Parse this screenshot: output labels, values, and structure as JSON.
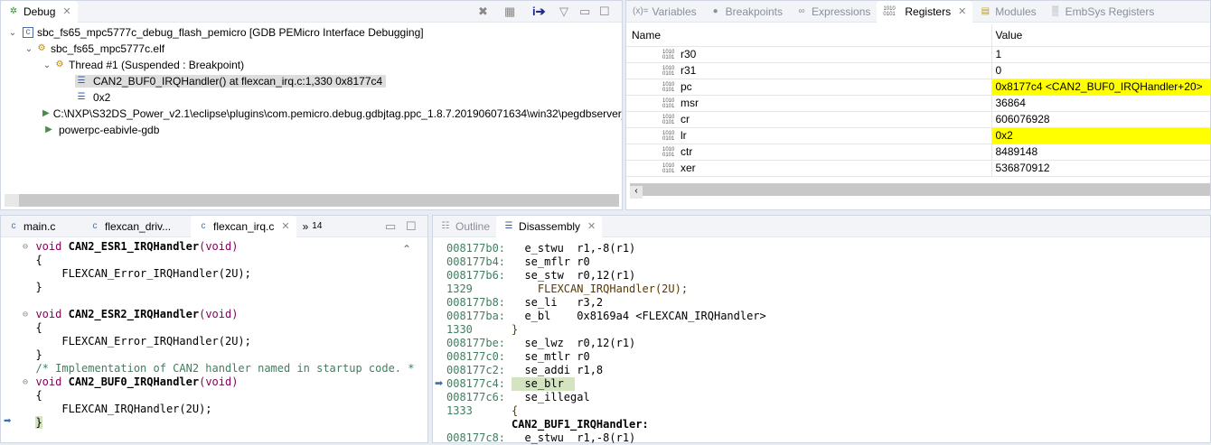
{
  "debug": {
    "tab": "Debug",
    "tree": [
      {
        "label": "sbc_fs65_mpc5777c_debug_flash_pemicro [GDB PEMicro Interface Debugging]"
      },
      {
        "label": "sbc_fs65_mpc5777c.elf"
      },
      {
        "label": "Thread #1 (Suspended : Breakpoint)"
      },
      {
        "label": "CAN2_BUF0_IRQHandler() at flexcan_irq.c:1,330 0x8177c4"
      },
      {
        "label": "0x2"
      },
      {
        "label": "C:\\NXP\\S32DS_Power_v2.1\\eclipse\\plugins\\com.pemicro.debug.gdbjtag.ppc_1.8.7.201906071634\\win32\\pegdbserver_"
      },
      {
        "label": "powerpc-eabivle-gdb"
      }
    ]
  },
  "views": {
    "tabs": [
      "Variables",
      "Breakpoints",
      "Expressions",
      "Registers",
      "Modules",
      "EmbSys Registers"
    ],
    "variables_prefix": "(x)="
  },
  "registers": {
    "headers": [
      "Name",
      "Value"
    ],
    "rows": [
      {
        "name": "r30",
        "value": "1"
      },
      {
        "name": "r31",
        "value": "0"
      },
      {
        "name": "pc",
        "value": "0x8177c4 <CAN2_BUF0_IRQHandler+20>",
        "changed": true
      },
      {
        "name": "msr",
        "value": "36864"
      },
      {
        "name": "cr",
        "value": "606076928"
      },
      {
        "name": "lr",
        "value": "0x2",
        "changed": true
      },
      {
        "name": "ctr",
        "value": "8489148"
      },
      {
        "name": "xer",
        "value": "536870912"
      }
    ],
    "highlight_color": "#ffff00",
    "bin_icon": "1010 0101"
  },
  "editor": {
    "tabs": [
      "main.c",
      "flexcan_driv...",
      "flexcan_irq.c"
    ],
    "overflow": "»",
    "overflow_count": "14",
    "lines": [
      {
        "kw": "void",
        "fn": "CAN2_ESR1_IRQHandler",
        "args": "(void)"
      },
      {
        "t": "{"
      },
      {
        "t": "    FLEXCAN_Error_IRQHandler(2U);"
      },
      {
        "t": "}"
      },
      {
        "t": ""
      },
      {
        "kw": "void",
        "fn": "CAN2_ESR2_IRQHandler",
        "args": "(void)"
      },
      {
        "t": "{"
      },
      {
        "t": "    FLEXCAN_Error_IRQHandler(2U);"
      },
      {
        "t": "}"
      },
      {
        "c": "/* Implementation of CAN2 handler named in startup code. *"
      },
      {
        "kw": "void",
        "fn": "CAN2_BUF0_IRQHandler",
        "args": "(void)"
      },
      {
        "t": "{"
      },
      {
        "t": "    FLEXCAN_IRQHandler(2U);"
      },
      {
        "t": "}"
      }
    ]
  },
  "disasm": {
    "tabs": [
      "Outline",
      "Disassembly"
    ],
    "lines": [
      {
        "a": "008177b0:",
        "i": "  e_stwu  r1,-8(r1)"
      },
      {
        "a": "008177b4:",
        "i": "  se_mflr r0"
      },
      {
        "a": "008177b6:",
        "i": "  se_stw  r0,12(r1)"
      },
      {
        "a": "1329",
        "i": "    FLEXCAN_IRQHandler(2U);"
      },
      {
        "a": "008177b8:",
        "i": "  se_li   r3,2"
      },
      {
        "a": "008177ba:",
        "i": "  e_bl    0x8169a4 <FLEXCAN_IRQHandler>"
      },
      {
        "a": "1330",
        "i": "}"
      },
      {
        "a": "008177be:",
        "i": "  se_lwz  r0,12(r1)"
      },
      {
        "a": "008177c0:",
        "i": "  se_mtlr r0"
      },
      {
        "a": "008177c2:",
        "i": "  se_addi r1,8"
      },
      {
        "a": "008177c4:",
        "i": "  se_blr"
      },
      {
        "a": "008177c6:",
        "i": "  se_illegal"
      },
      {
        "a": "1333",
        "i": "{"
      },
      {
        "a": "",
        "i": "CAN2_BUF1_IRQHandler:"
      },
      {
        "a": "008177c8:",
        "i": "  e_stwu  r1,-8(r1)"
      }
    ]
  }
}
